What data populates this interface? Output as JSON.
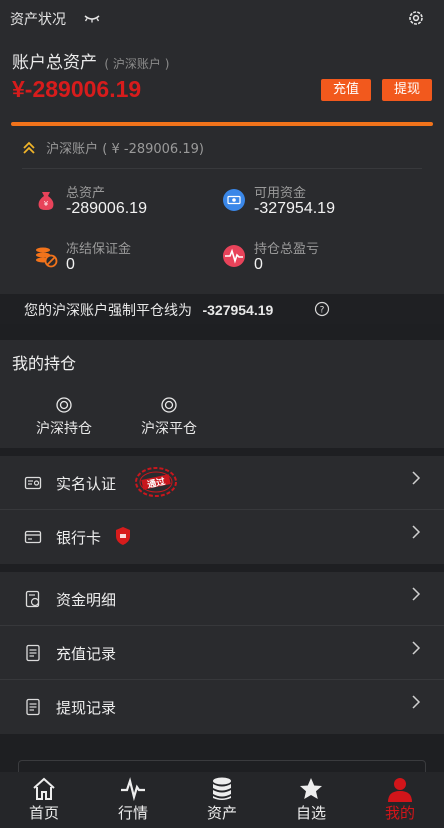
{
  "topbar": {
    "title": "资产状况",
    "eye_icon": "eye-closed-icon",
    "settings_icon": "gear-icon"
  },
  "account": {
    "title": "账户总资产",
    "subtitle": "( 沪深账户 )",
    "balance": "¥-289006.19",
    "recharge_label": "充值",
    "withdraw_label": "提现",
    "sub_account": "沪深账户 ( ¥ -289006.19)"
  },
  "stats": [
    {
      "label": "总资产",
      "value": "-289006.19",
      "icon": "money-bag-icon",
      "color": "#e8435a"
    },
    {
      "label": "可用资金",
      "value": "-327954.19",
      "icon": "cash-icon",
      "color": "#3a87e8"
    },
    {
      "label": "冻结保证金",
      "value": "0",
      "icon": "frozen-coins-icon",
      "color": "#f2731b"
    },
    {
      "label": "持仓总盈亏",
      "value": "0",
      "icon": "pulse-icon",
      "color": "#e8435a"
    }
  ],
  "liquidation": {
    "text": "您的沪深账户强制平仓线为",
    "value": "-327954.19"
  },
  "holdings": {
    "title": "我的持仓",
    "items": [
      {
        "label": "沪深持仓",
        "icon": "target-icon"
      },
      {
        "label": "沪深平仓",
        "icon": "target-icon"
      }
    ]
  },
  "menu1": [
    {
      "label": "实名认证",
      "icon": "id-card-icon",
      "stamp": "通过"
    },
    {
      "label": "银行卡",
      "icon": "bank-card-icon"
    }
  ],
  "menu2": [
    {
      "label": "资金明细",
      "icon": "fund-detail-icon"
    },
    {
      "label": "充值记录",
      "icon": "document-icon"
    },
    {
      "label": "提现记录",
      "icon": "document-icon"
    }
  ],
  "tabs": [
    {
      "label": "首页",
      "icon": "home-icon"
    },
    {
      "label": "行情",
      "icon": "pulse-icon"
    },
    {
      "label": "资产",
      "icon": "database-icon"
    },
    {
      "label": "自选",
      "icon": "star-icon"
    },
    {
      "label": "我的",
      "icon": "user-icon",
      "active": true
    }
  ],
  "colors": {
    "accent": "#f2591d",
    "negative": "#d71c1c",
    "active_tab": "#d2151a"
  }
}
